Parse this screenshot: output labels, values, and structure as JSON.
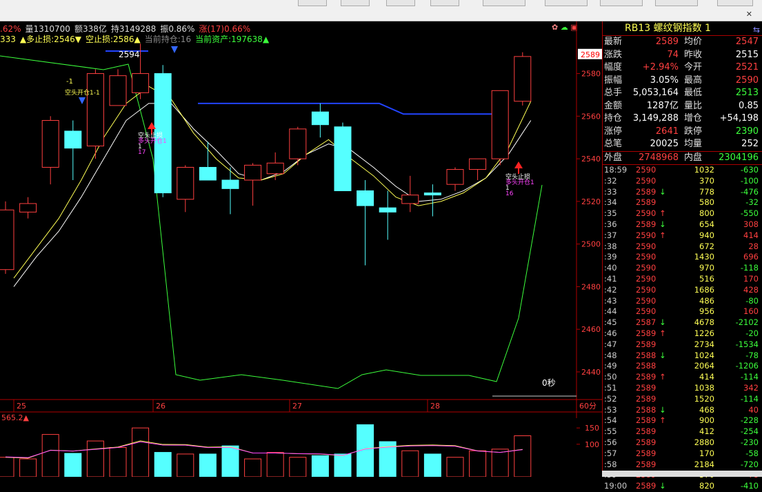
{
  "info_line1": [
    {
      "text": ".62%",
      "color": "#ff4040"
    },
    {
      "text": "量1310700",
      "color": "#dddddd"
    },
    {
      "text": "额338亿",
      "color": "#dddddd"
    },
    {
      "text": "持3149288",
      "color": "#dddddd"
    },
    {
      "text": "振0.86%",
      "color": "#dddddd"
    },
    {
      "text": "涨(17)0.66%",
      "color": "#ff4040"
    }
  ],
  "info_line2": [
    {
      "text": "333",
      "color": "#ffff55"
    },
    {
      "text": "▲多止损:2546▼",
      "color": "#ffff55"
    },
    {
      "text": "空止损:2586▲",
      "color": "#ffff55"
    },
    {
      "text": "当前持仓:16",
      "color": "#888888"
    },
    {
      "text": "当前资产:197638▲",
      "color": "#3cff3c"
    }
  ],
  "price_axis": [
    "2580",
    "2560",
    "2540",
    "2520",
    "2500",
    "2480",
    "2460",
    "2440"
  ],
  "current_price_tag": "2589",
  "date_labels": [
    "25",
    "26",
    "27",
    "28"
  ],
  "period_label": "60分",
  "countdown": "0秒",
  "annotations": {
    "label_2594": "2594",
    "short_open_top": "-1",
    "short_open": "空头开仓1-1",
    "long_open_26": "多头开仓1",
    "long_open_26_sub": "1",
    "long_open_26_num": "17",
    "short_stop_26": "空头止损",
    "short_stop_28": "空头止损",
    "long_open_28": "多头开仓1",
    "long_open_28_sub": "1",
    "long_open_28_num": "16"
  },
  "volume_info": "565.2▲",
  "volume_axis": [
    "150",
    "100"
  ],
  "panel": {
    "title": "RB13  螺纹钢指数  1",
    "quote_rows": [
      {
        "l1": "最新",
        "v1": "2589",
        "c1": "red",
        "l2": "均价",
        "v2": "2547",
        "c2": "red"
      },
      {
        "l1": "涨跌",
        "v1": "74",
        "c1": "red",
        "l2": "昨收",
        "v2": "2515",
        "c2": "white"
      },
      {
        "l1": "幅度",
        "v1": "+2.94%",
        "c1": "red",
        "l2": "今开",
        "v2": "2521",
        "c2": "red"
      },
      {
        "l1": "振幅",
        "v1": "3.05%",
        "c1": "white",
        "l2": "最高",
        "v2": "2590",
        "c2": "red"
      },
      {
        "l1": "总手",
        "v1": "5,053,164",
        "c1": "white",
        "l2": "最低",
        "v2": "2513",
        "c2": "green"
      },
      {
        "l1": "金额",
        "v1": "1287亿",
        "c1": "white",
        "l2": "量比",
        "v2": "0.85",
        "c2": "white"
      },
      {
        "l1": "持仓",
        "v1": "3,149,288",
        "c1": "white",
        "l2": "增仓",
        "v2": "+54,198",
        "c2": "white"
      },
      {
        "l1": "涨停",
        "v1": "2641",
        "c1": "red",
        "l2": "跌停",
        "v2": "2390",
        "c2": "green"
      },
      {
        "l1": "总笔",
        "v1": "20025",
        "c1": "white",
        "l2": "均量",
        "v2": "252",
        "c2": "white"
      }
    ],
    "outer_label": "外盘",
    "outer_value": "2748968",
    "inner_label": "内盘",
    "inner_value": "2304196",
    "ticks": [
      {
        "t": "18:59",
        "p": "2590",
        "a": "",
        "v": "1032",
        "c": "-630"
      },
      {
        "t": ":32",
        "p": "2590",
        "a": "",
        "v": "370",
        "c": "-100"
      },
      {
        "t": ":33",
        "p": "2589",
        "a": "↓",
        "v": "778",
        "c": "-476"
      },
      {
        "t": ":34",
        "p": "2589",
        "a": "",
        "v": "580",
        "c": "-32"
      },
      {
        "t": ":35",
        "p": "2590",
        "a": "↑",
        "v": "800",
        "c": "-550"
      },
      {
        "t": ":36",
        "p": "2589",
        "a": "↓",
        "v": "654",
        "c": "308"
      },
      {
        "t": ":37",
        "p": "2590",
        "a": "↑",
        "v": "940",
        "c": "414"
      },
      {
        "t": ":38",
        "p": "2590",
        "a": "",
        "v": "672",
        "c": "28"
      },
      {
        "t": ":39",
        "p": "2590",
        "a": "",
        "v": "1430",
        "c": "696"
      },
      {
        "t": ":40",
        "p": "2590",
        "a": "",
        "v": "970",
        "c": "-118"
      },
      {
        "t": ":41",
        "p": "2590",
        "a": "",
        "v": "516",
        "c": "170"
      },
      {
        "t": ":42",
        "p": "2590",
        "a": "",
        "v": "1686",
        "c": "428"
      },
      {
        "t": ":43",
        "p": "2590",
        "a": "",
        "v": "486",
        "c": "-80"
      },
      {
        "t": ":44",
        "p": "2590",
        "a": "",
        "v": "956",
        "c": "160"
      },
      {
        "t": ":45",
        "p": "2587",
        "a": "↓",
        "v": "4678",
        "c": "-2102"
      },
      {
        "t": ":46",
        "p": "2589",
        "a": "↑",
        "v": "1226",
        "c": "-20"
      },
      {
        "t": ":47",
        "p": "2589",
        "a": "",
        "v": "2734",
        "c": "-1534"
      },
      {
        "t": ":48",
        "p": "2588",
        "a": "↓",
        "v": "1024",
        "c": "-78"
      },
      {
        "t": ":49",
        "p": "2588",
        "a": "",
        "v": "2064",
        "c": "-1206"
      },
      {
        "t": ":50",
        "p": "2589",
        "a": "↑",
        "v": "414",
        "c": "-114"
      },
      {
        "t": ":51",
        "p": "2589",
        "a": "",
        "v": "1038",
        "c": "342"
      },
      {
        "t": ":52",
        "p": "2589",
        "a": "",
        "v": "1520",
        "c": "-114"
      },
      {
        "t": ":53",
        "p": "2588",
        "a": "↓",
        "v": "468",
        "c": "40"
      },
      {
        "t": ":54",
        "p": "2589",
        "a": "↑",
        "v": "900",
        "c": "-228"
      },
      {
        "t": ":55",
        "p": "2589",
        "a": "",
        "v": "412",
        "c": "-254"
      },
      {
        "t": ":56",
        "p": "2589",
        "a": "",
        "v": "2880",
        "c": "-230"
      },
      {
        "t": ":57",
        "p": "2589",
        "a": "",
        "v": "170",
        "c": "-58"
      },
      {
        "t": ":58",
        "p": "2589",
        "a": "",
        "v": "2184",
        "c": "-720"
      },
      {
        "t": ":59",
        "p": "2589",
        "a": "",
        "v": "370",
        "c": "78"
      },
      {
        "t": "19:00",
        "p": "2589",
        "a": "↓",
        "v": "820",
        "c": "-410"
      }
    ]
  },
  "chart_data": {
    "type": "candlestick",
    "interval": "60分",
    "ylim": [
      2428,
      2598
    ],
    "candles": [
      {
        "o": 2488,
        "h": 2520,
        "l": 2486,
        "c": 2516
      },
      {
        "o": 2515,
        "h": 2522,
        "l": 2512,
        "c": 2519
      },
      {
        "o": 2536,
        "h": 2560,
        "l": 2528,
        "c": 2558
      },
      {
        "o": 2553,
        "h": 2558,
        "l": 2530,
        "c": 2545
      },
      {
        "o": 2546,
        "h": 2582,
        "l": 2540,
        "c": 2580
      },
      {
        "o": 2565,
        "h": 2582,
        "l": 2565,
        "c": 2579
      },
      {
        "o": 2571,
        "h": 2594,
        "l": 2568,
        "c": 2580
      },
      {
        "o": 2580,
        "h": 2584,
        "l": 2522,
        "c": 2524
      },
      {
        "o": 2521,
        "h": 2537,
        "l": 2515,
        "c": 2536
      },
      {
        "o": 2536,
        "h": 2548,
        "l": 2530,
        "c": 2530
      },
      {
        "o": 2530,
        "h": 2536,
        "l": 2514,
        "c": 2526
      },
      {
        "o": 2530,
        "h": 2538,
        "l": 2518,
        "c": 2537
      },
      {
        "o": 2533,
        "h": 2543,
        "l": 2530,
        "c": 2538
      },
      {
        "o": 2540,
        "h": 2555,
        "l": 2537,
        "c": 2554
      },
      {
        "o": 2562,
        "h": 2566,
        "l": 2550,
        "c": 2556
      },
      {
        "o": 2555,
        "h": 2557,
        "l": 2525,
        "c": 2525
      },
      {
        "o": 2525,
        "h": 2530,
        "l": 2490,
        "c": 2518
      },
      {
        "o": 2517,
        "h": 2525,
        "l": 2502,
        "c": 2515
      },
      {
        "o": 2519,
        "h": 2532,
        "l": 2515,
        "c": 2523
      },
      {
        "o": 2524,
        "h": 2528,
        "l": 2513,
        "c": 2523
      },
      {
        "o": 2528,
        "h": 2536,
        "l": 2525,
        "c": 2535
      },
      {
        "o": 2535,
        "h": 2540,
        "l": 2530,
        "c": 2540
      },
      {
        "o": 2540,
        "h": 2553,
        "l": 2537,
        "c": 2572
      },
      {
        "o": 2567,
        "h": 2590,
        "l": 2565,
        "c": 2588
      }
    ],
    "ma_yellow": [
      2484,
      2498,
      2512,
      2530,
      2550,
      2566,
      2574,
      2568,
      2552,
      2540,
      2531,
      2530,
      2533,
      2542,
      2549,
      2540,
      2532,
      2522,
      2518,
      2520,
      2524,
      2531,
      2545,
      2567
    ],
    "ma_white": [
      2480,
      2494,
      2506,
      2522,
      2540,
      2558,
      2566,
      2566,
      2554,
      2544,
      2533,
      2530,
      2534,
      2542,
      2547,
      2544,
      2536,
      2527,
      2520,
      2521,
      2525,
      2531,
      2542,
      2558
    ],
    "blue_line": [
      {
        "x0": 8.5,
        "x1": 16,
        "y": 2566
      },
      {
        "x0": 17,
        "x1": 21.5,
        "y": 2561
      }
    ],
    "volume": {
      "ylim": [
        0,
        180
      ],
      "values": [
        60,
        55,
        130,
        72,
        110,
        90,
        150,
        75,
        70,
        70,
        95,
        55,
        75,
        60,
        65,
        70,
        160,
        108,
        80,
        70,
        60,
        80,
        85,
        126
      ]
    }
  }
}
